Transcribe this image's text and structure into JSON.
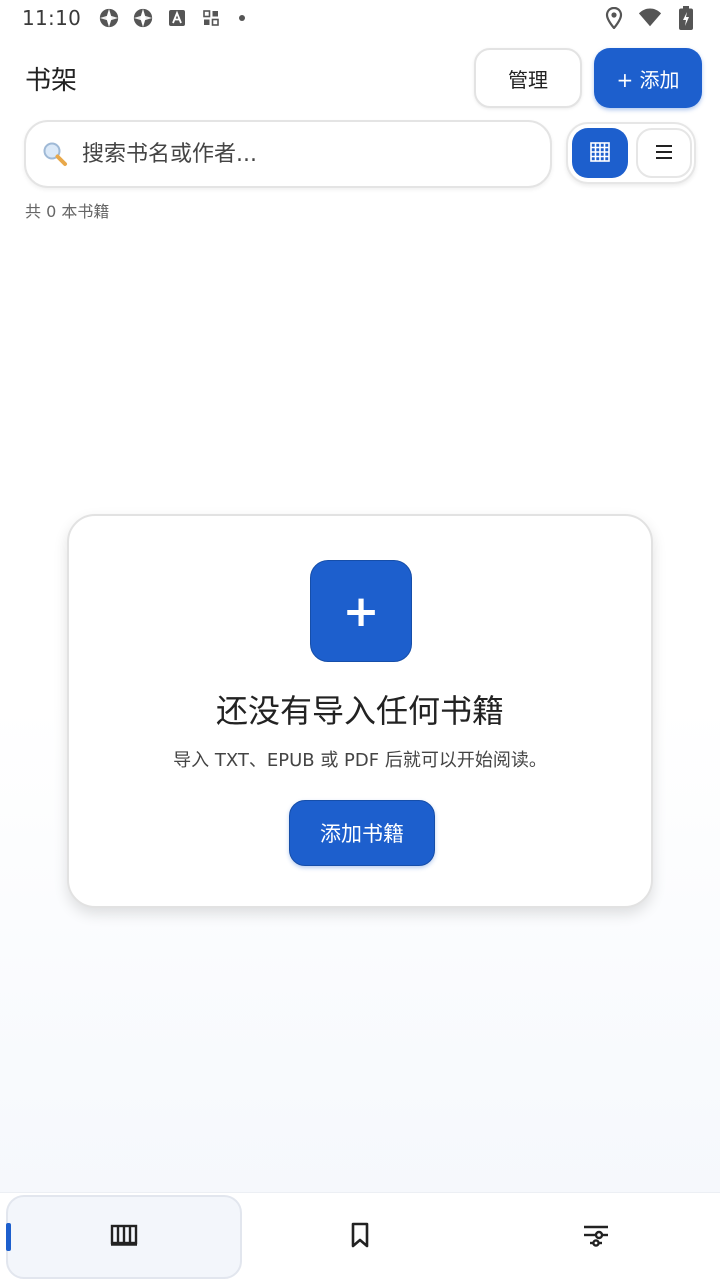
{
  "status_bar": {
    "time": "11:10",
    "left_icons": [
      "app-icon-1",
      "app-icon-2",
      "a-text-icon",
      "grid-apps-icon",
      "more-dot-icon"
    ],
    "right_icons": [
      "location-icon",
      "wifi-icon",
      "battery-charging-icon"
    ]
  },
  "header": {
    "title": "书架",
    "manage_label": "管理",
    "add_label": "+ 添加"
  },
  "search": {
    "placeholder": "搜索书名或作者..."
  },
  "view_toggle": {
    "grid_icon": "grid-view-icon",
    "list_icon": "list-view-icon",
    "active": "grid"
  },
  "book_count": "共 0 本书籍",
  "empty_state": {
    "plus": "+",
    "title": "还没有导入任何书籍",
    "description": "导入 TXT、EPUB 或 PDF 后就可以开始阅读。",
    "button_label": "添加书籍"
  },
  "bottom_nav": {
    "items": [
      {
        "icon": "bookshelf-icon",
        "active": true
      },
      {
        "icon": "bookmark-icon",
        "active": false
      },
      {
        "icon": "settings-sliders-icon",
        "active": false
      }
    ]
  },
  "colors": {
    "accent": "#1d5fcd"
  }
}
